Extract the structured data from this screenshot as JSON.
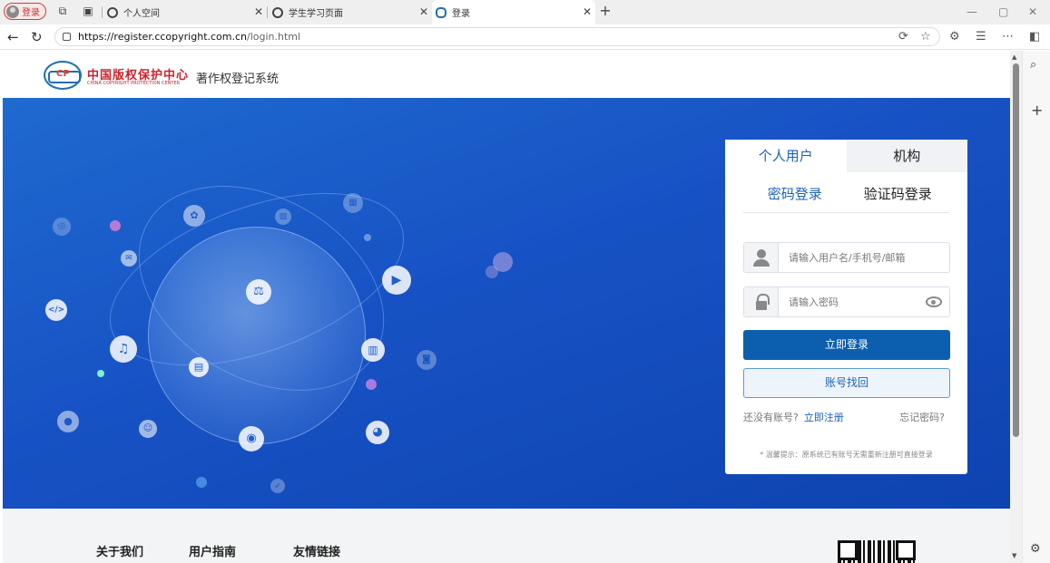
{
  "browser": {
    "profile_label": "登录",
    "tabs": [
      {
        "title": "个人空间"
      },
      {
        "title": "学生学习页面"
      },
      {
        "title": "登录"
      }
    ],
    "url_domain": "https://register.ccopyright.com.cn",
    "url_path": "/login.html"
  },
  "header": {
    "brand_cn": "中国版权保护中心",
    "brand_en": "CHINA COPYRIGHT PROTECTION CENTER",
    "system_name": "著作权登记系统"
  },
  "login": {
    "user_tabs": [
      "个人用户",
      "机构"
    ],
    "method_tabs": [
      "密码登录",
      "验证码登录"
    ],
    "username_placeholder": "请输入用户名/手机号/邮箱",
    "password_placeholder": "请输入密码",
    "login_button": "立即登录",
    "recover_button": "账号找回",
    "no_account_text": "还没有账号?",
    "register_link": "立即注册",
    "forgot_link": "忘记密码?",
    "tip": "* 温馨提示：原系统已有账号无需重新注册可直接登录"
  },
  "footer": {
    "links": [
      "关于我们",
      "用户指南",
      "友情链接"
    ]
  },
  "colors": {
    "primary": "#0c5fae",
    "banner": "#1752c4",
    "brand_red": "#c8242b"
  }
}
